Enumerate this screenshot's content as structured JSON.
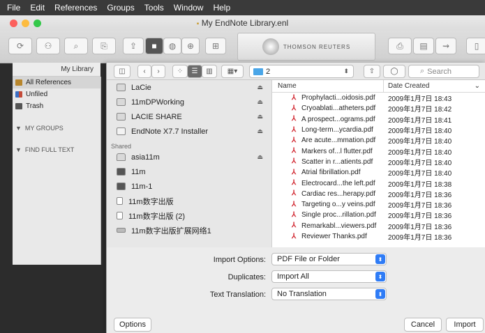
{
  "menubar": {
    "items": [
      "File",
      "Edit",
      "References",
      "Groups",
      "Tools",
      "Window",
      "Help"
    ]
  },
  "window": {
    "title": "My EndNote Library.enl"
  },
  "toolbar": {
    "logo_text": "THOMSON REUTERS"
  },
  "library": {
    "header": "My Library",
    "items": [
      {
        "label": "All References",
        "icon": "all-references-icon",
        "color": "#b8862c",
        "selected": true
      },
      {
        "label": "Unfiled",
        "icon": "unfiled-icon",
        "color": "#3a6fc4",
        "selected": false
      },
      {
        "label": "Trash",
        "icon": "trash-icon",
        "color": "#555555",
        "selected": false
      }
    ],
    "groups": [
      {
        "label": "MY GROUPS"
      },
      {
        "label": "FIND FULL TEXT"
      }
    ]
  },
  "dialog": {
    "path_value": "2",
    "search_placeholder": "Search",
    "locations": [
      {
        "label": "LaCie",
        "eject": true
      },
      {
        "label": "11mDPWorking",
        "eject": true
      },
      {
        "label": "LACIE SHARE",
        "eject": true
      },
      {
        "label": "EndNote X7.7 Installer",
        "eject": true
      }
    ],
    "shared_header": "Shared",
    "shared": [
      {
        "label": "asia11m",
        "eject": true
      },
      {
        "label": "11m",
        "eject": false
      },
      {
        "label": "11m-1",
        "eject": false
      },
      {
        "label": "11m数字出版",
        "eject": false
      },
      {
        "label": "11m数字出版 (2)",
        "eject": false
      },
      {
        "label": "11m数字出版扩展网络1",
        "eject": false
      }
    ],
    "columns": {
      "name": "Name",
      "date": "Date Created"
    },
    "files": [
      {
        "name": "Prophylacti...oidosis.pdf",
        "date": "2009年1月7日 18:43"
      },
      {
        "name": "Cryoablati...atheters.pdf",
        "date": "2009年1月7日 18:42"
      },
      {
        "name": "A prospect...ograms.pdf",
        "date": "2009年1月7日 18:41"
      },
      {
        "name": "Long-term...ycardia.pdf",
        "date": "2009年1月7日 18:40"
      },
      {
        "name": "Are acute...mmation.pdf",
        "date": "2009年1月7日 18:40"
      },
      {
        "name": "Markers of...l flutter.pdf",
        "date": "2009年1月7日 18:40"
      },
      {
        "name": "Scatter in r...atients.pdf",
        "date": "2009年1月7日 18:40"
      },
      {
        "name": "Atrial fibrillation.pdf",
        "date": "2009年1月7日 18:40"
      },
      {
        "name": "Electrocard...the left.pdf",
        "date": "2009年1月7日 18:38"
      },
      {
        "name": "Cardiac res...herapy.pdf",
        "date": "2009年1月7日 18:36"
      },
      {
        "name": "Targeting o...y veins.pdf",
        "date": "2009年1月7日 18:36"
      },
      {
        "name": "Single proc...rillation.pdf",
        "date": "2009年1月7日 18:36"
      },
      {
        "name": "Remarkabl...viewers.pdf",
        "date": "2009年1月7日 18:36"
      },
      {
        "name": "Reviewer Thanks.pdf",
        "date": "2009年1月7日 18:36"
      }
    ],
    "options": {
      "import_label": "Import Options:",
      "import_value": "PDF File or Folder",
      "duplicates_label": "Duplicates:",
      "duplicates_value": "Import All",
      "translation_label": "Text Translation:",
      "translation_value": "No Translation"
    },
    "buttons": {
      "options": "Options",
      "cancel": "Cancel",
      "import": "Import"
    }
  }
}
